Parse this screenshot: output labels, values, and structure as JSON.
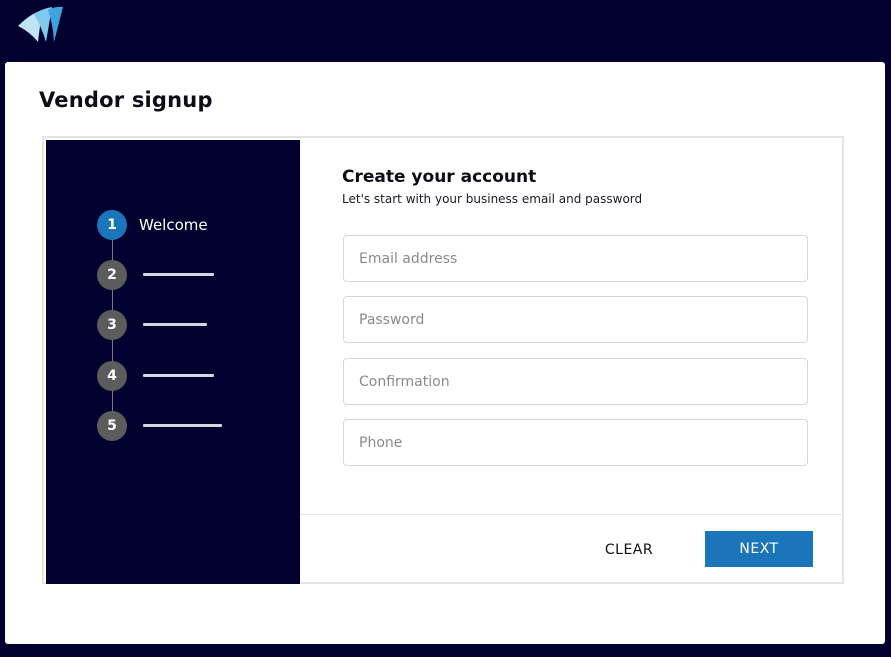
{
  "header": {
    "logo_icon": "sail-logo-icon"
  },
  "page": {
    "title": "Vendor signup"
  },
  "steps": [
    {
      "number": "1",
      "label": "Welcome",
      "active": true
    },
    {
      "number": "2",
      "label": "",
      "active": false
    },
    {
      "number": "3",
      "label": "",
      "active": false
    },
    {
      "number": "4",
      "label": "",
      "active": false
    },
    {
      "number": "5",
      "label": "",
      "active": false
    }
  ],
  "form": {
    "title": "Create your account",
    "subtitle": "Let's start with your business email and password",
    "email": {
      "placeholder": "Email address",
      "value": ""
    },
    "password": {
      "placeholder": "Password",
      "value": ""
    },
    "confirmation": {
      "placeholder": "Confirmation",
      "value": ""
    },
    "phone": {
      "placeholder": "Phone",
      "value": ""
    }
  },
  "actions": {
    "clear_label": "CLEAR",
    "next_label": "NEXT"
  },
  "colors": {
    "background": "#01002f",
    "accent": "#1a75bb",
    "inactive_step": "#5c5c5c"
  }
}
